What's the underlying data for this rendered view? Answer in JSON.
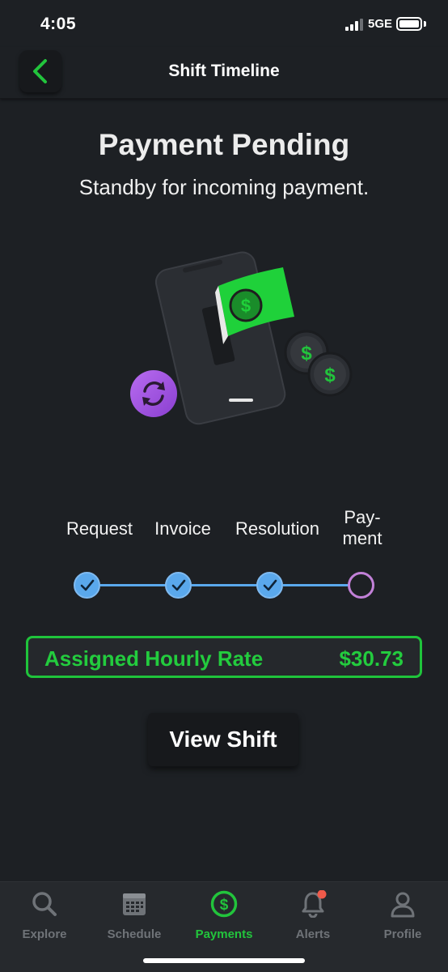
{
  "status_bar": {
    "time": "4:05",
    "network": "5GE"
  },
  "header": {
    "title": "Shift Timeline",
    "back_icon": "chevron-left-icon"
  },
  "main": {
    "title": "Payment Pending",
    "subtitle": "Standby for incoming payment.",
    "illustration": {
      "icons": [
        "phone-icon",
        "cash-bill-icon",
        "dollar-coin-icon",
        "refresh-icon"
      ]
    },
    "steps": [
      {
        "label_line1": "Request",
        "label_line2": "",
        "state": "done"
      },
      {
        "label_line1": "Invoice",
        "label_line2": "",
        "state": "done"
      },
      {
        "label_line1": "Resolution",
        "label_line2": "",
        "state": "done"
      },
      {
        "label_line1": "Pay-",
        "label_line2": "ment",
        "state": "pending"
      }
    ],
    "rate": {
      "label": "Assigned Hourly Rate",
      "value": "$30.73"
    },
    "view_shift_label": "View Shift"
  },
  "bottom_nav": {
    "items": [
      {
        "label": "Explore",
        "icon": "search-icon",
        "active": false
      },
      {
        "label": "Schedule",
        "icon": "calendar-icon",
        "active": false
      },
      {
        "label": "Payments",
        "icon": "dollar-circle-icon",
        "active": true
      },
      {
        "label": "Alerts",
        "icon": "bell-icon",
        "active": false,
        "badge": true
      },
      {
        "label": "Profile",
        "icon": "person-icon",
        "active": false
      }
    ]
  },
  "colors": {
    "background": "#1d2024",
    "accent_green": "#22c43c",
    "step_done_blue": "#5aa8ec",
    "step_pending_purple": "#c281d8",
    "alert_badge": "#f05a4a"
  }
}
